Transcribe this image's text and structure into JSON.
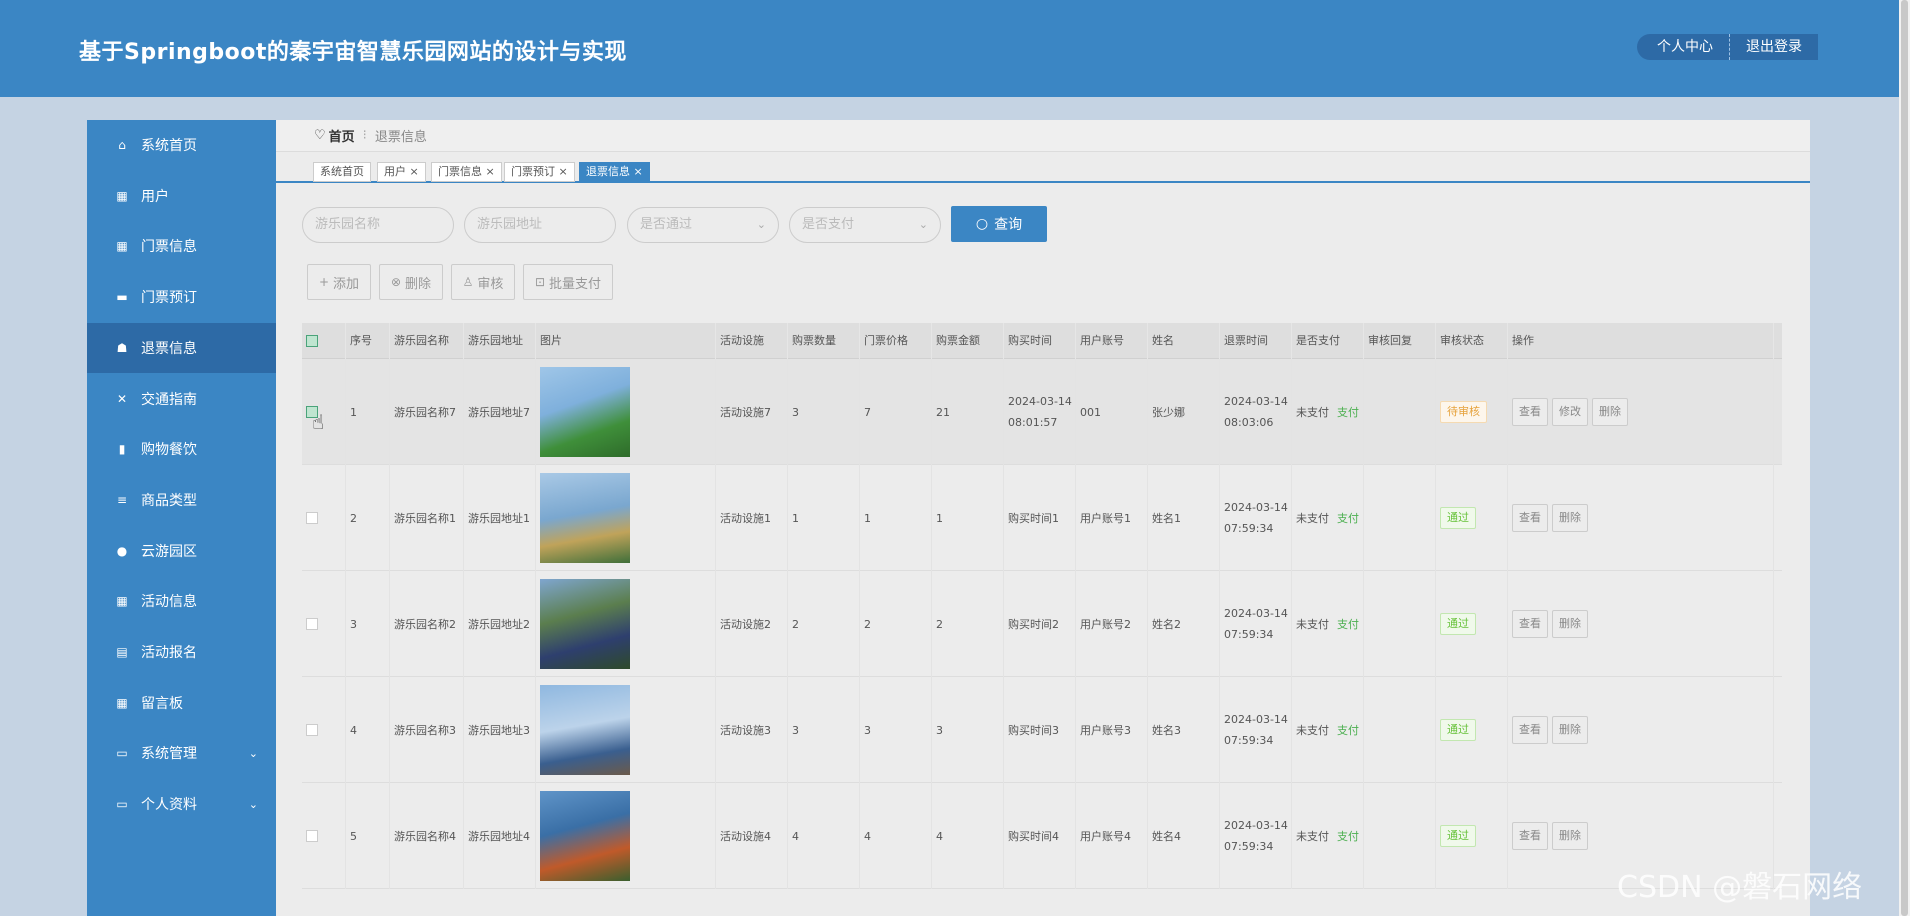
{
  "header": {
    "title": "基于Springboot的秦宇宙智慧乐园网站的设计与实现",
    "buttons": [
      "个人中心",
      "退出登录"
    ]
  },
  "sidebar": {
    "items": [
      {
        "label": "系统首页",
        "icon": "home-icon",
        "glyph": "⌂"
      },
      {
        "label": "用户",
        "icon": "grid-icon",
        "glyph": "▦"
      },
      {
        "label": "门票信息",
        "icon": "grid-icon",
        "glyph": "▦"
      },
      {
        "label": "门票预订",
        "icon": "briefcase-icon",
        "glyph": "▬"
      },
      {
        "label": "退票信息",
        "icon": "thumbs-up-icon",
        "glyph": "☗"
      },
      {
        "label": "交通指南",
        "icon": "link-icon",
        "glyph": "✕"
      },
      {
        "label": "购物餐饮",
        "icon": "bar-chart-icon",
        "glyph": "▮"
      },
      {
        "label": "商品类型",
        "icon": "list-icon",
        "glyph": "≡"
      },
      {
        "label": "云游园区",
        "icon": "user-icon",
        "glyph": "●"
      },
      {
        "label": "活动信息",
        "icon": "grid-icon",
        "glyph": "▦"
      },
      {
        "label": "活动报名",
        "icon": "clipboard-icon",
        "glyph": "▤"
      },
      {
        "label": "留言板",
        "icon": "grid-icon",
        "glyph": "▦"
      },
      {
        "label": "系统管理",
        "icon": "monitor-icon",
        "glyph": "▭",
        "arrow": "⌄"
      },
      {
        "label": "个人资料",
        "icon": "id-card-icon",
        "glyph": "▭",
        "arrow": "⌄"
      }
    ],
    "active_index": 4
  },
  "breadcrumb": {
    "home": "首页",
    "separator": "⁝",
    "current": "退票信息"
  },
  "tabs": [
    {
      "label": "系统首页"
    },
    {
      "label": "用户 ×"
    },
    {
      "label": "门票信息 ×"
    },
    {
      "label": "门票预订 ×"
    },
    {
      "label": "退票信息 ×",
      "active": true
    }
  ],
  "filters": {
    "park_name_placeholder": "游乐园名称",
    "park_address_placeholder": "游乐园地址",
    "passed_placeholder": "是否通过",
    "paid_placeholder": "是否支付",
    "query_label": "查询"
  },
  "actions": [
    {
      "label": "添加",
      "glyph": "+"
    },
    {
      "label": "删除",
      "glyph": "⊗"
    },
    {
      "label": "审核",
      "glyph": "♙"
    },
    {
      "label": "批量支付",
      "glyph": "⊡"
    }
  ],
  "table": {
    "columns": [
      "序号",
      "游乐园名称",
      "游乐园地址",
      "图片",
      "活动设施",
      "购票数量",
      "门票价格",
      "购票金额",
      "购买时间",
      "用户账号",
      "姓名",
      "退票时间",
      "是否支付",
      "审核回复",
      "审核状态",
      "操作"
    ],
    "rows": [
      {
        "no": "1",
        "name": "游乐园名称7",
        "addr": "游乐园地址7",
        "facility": "活动设施7",
        "qty": "3",
        "price": "7",
        "amount": "21",
        "buy_time_1": "2024-03-14",
        "buy_time_2": "08:01:57",
        "account": "001",
        "person": "张少娜",
        "refund_1": "2024-03-14",
        "refund_2": "08:03:06",
        "paid": "未支付",
        "pay": "支付",
        "reply": "",
        "status": "待审核",
        "ops": [
          "查看",
          "修改",
          "删除"
        ],
        "checked": true
      },
      {
        "no": "2",
        "name": "游乐园名称1",
        "addr": "游乐园地址1",
        "facility": "活动设施1",
        "qty": "1",
        "price": "1",
        "amount": "1",
        "buy_time_1": "购买时间1",
        "buy_time_2": "",
        "account": "用户账号1",
        "person": "姓名1",
        "refund_1": "2024-03-14",
        "refund_2": "07:59:34",
        "paid": "未支付",
        "pay": "支付",
        "reply": "",
        "status": "通过",
        "ops": [
          "查看",
          "删除"
        ],
        "checked": false
      },
      {
        "no": "3",
        "name": "游乐园名称2",
        "addr": "游乐园地址2",
        "facility": "活动设施2",
        "qty": "2",
        "price": "2",
        "amount": "2",
        "buy_time_1": "购买时间2",
        "buy_time_2": "",
        "account": "用户账号2",
        "person": "姓名2",
        "refund_1": "2024-03-14",
        "refund_2": "07:59:34",
        "paid": "未支付",
        "pay": "支付",
        "reply": "",
        "status": "通过",
        "ops": [
          "查看",
          "删除"
        ],
        "checked": false
      },
      {
        "no": "4",
        "name": "游乐园名称3",
        "addr": "游乐园地址3",
        "facility": "活动设施3",
        "qty": "3",
        "price": "3",
        "amount": "3",
        "buy_time_1": "购买时间3",
        "buy_time_2": "",
        "account": "用户账号3",
        "person": "姓名3",
        "refund_1": "2024-03-14",
        "refund_2": "07:59:34",
        "paid": "未支付",
        "pay": "支付",
        "reply": "",
        "status": "通过",
        "ops": [
          "查看",
          "删除"
        ],
        "checked": false
      },
      {
        "no": "5",
        "name": "游乐园名称4",
        "addr": "游乐园地址4",
        "facility": "活动设施4",
        "qty": "4",
        "price": "4",
        "amount": "4",
        "buy_time_1": "购买时间4",
        "buy_time_2": "",
        "account": "用户账号4",
        "person": "姓名4",
        "refund_1": "2024-03-14",
        "refund_2": "07:59:34",
        "paid": "未支付",
        "pay": "支付",
        "reply": "",
        "status": "通过",
        "ops": [
          "查看",
          "删除"
        ],
        "checked": false
      }
    ]
  },
  "watermark": "CSDN @磐石网络",
  "colors": {
    "primary": "#3b86c4",
    "primary_dark": "#2d6aa6",
    "pending": "#e6a23c",
    "success": "#67c23a"
  }
}
